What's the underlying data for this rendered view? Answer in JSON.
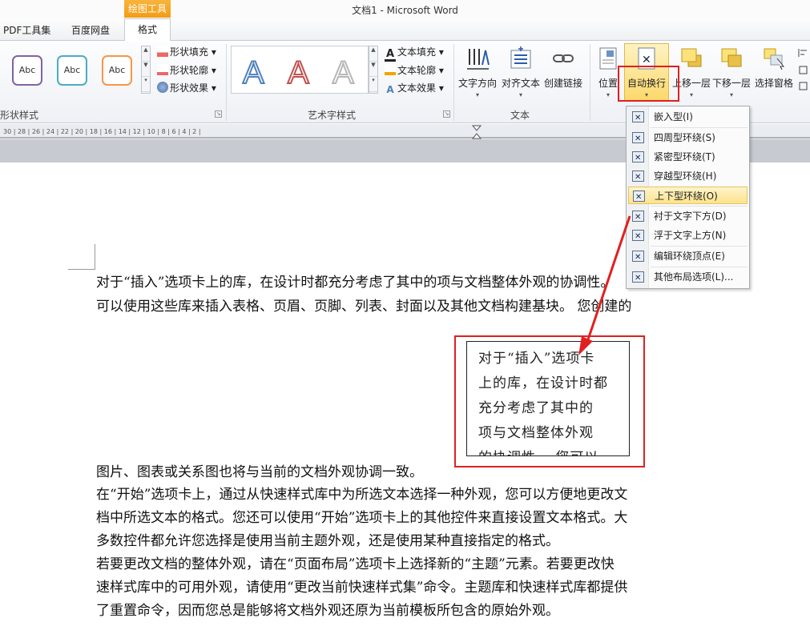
{
  "window": {
    "title": "文档1 - Microsoft Word"
  },
  "tabs": {
    "context_group": "绘图工具",
    "pdf": "PDF工具集",
    "baidu": "百度网盘",
    "format": "格式"
  },
  "ribbon": {
    "shape_styles": {
      "label": "形状样式",
      "sample": "Abc",
      "fill": "形状填充",
      "outline": "形状轮廓",
      "effect": "形状效果"
    },
    "wordart": {
      "label": "艺术字样式",
      "fill": "文本填充",
      "outline": "文本轮廓",
      "effect": "文本效果"
    },
    "text": {
      "label": "文本",
      "direction": "文字方向",
      "align": "对齐文本",
      "link": "创建链接"
    },
    "arrange": {
      "position": "位置",
      "wrap": "自动换行",
      "forward": "上移一层",
      "backward": "下移一层",
      "pane": "选择窗格"
    }
  },
  "ruler": {
    "numbers": "30 | 28 | 26 | 24 | 22 | 20 | 18 | 16 | 14 | 12 | 10 | 8 | 6 | 4 | 2 |"
  },
  "wrap_menu": {
    "items": [
      "嵌入型(I)",
      "四周型环绕(S)",
      "紧密型环绕(T)",
      "穿越型环绕(H)",
      "上下型环绕(O)",
      "衬于文字下方(D)",
      "浮于文字上方(N)",
      "编辑环绕顶点(E)",
      "其他布局选项(L)..."
    ],
    "highlighted": "上下型环绕(O)"
  },
  "document": {
    "para1_line1": "对于“插入”选项卡上的库，在设计时都充分考虑了其中的项与文档整体外观的协调性。",
    "para1_line2": "可以使用这些库来插入表格、页眉、页脚、列表、封面以及其他文档构建基块。 您创建的",
    "after_box": "图片、图表或关系图也将与当前的文档外观协调一致。",
    "para2_line1": "在“开始”选项卡上，通过从快速样式库中为所选文本选择一种外观，您可以方便地更改文",
    "para2_line2": "档中所选文本的格式。您还可以使用“开始”选项卡上的其他控件来直接设置文本格式。大",
    "para2_line3": "多数控件都允许您选择是使用当前主题外观，还是使用某种直接指定的格式。",
    "para3_line1": "若要更改文档的整体外观，请在“页面布局”选项卡上选择新的“主题”元素。若要更改快",
    "para3_line2": "速样式库中的可用外观，请使用“更改当前快速样式集”命令。主题库和快速样式库都提供",
    "para3_line3": "了重置命令，因而您总是能够将文档外观还原为当前模板所包含的原始外观。",
    "textbox_lines": [
      "对于“插入”选项卡",
      "上的库，在设计时都",
      "充分考虑了其中的",
      "项与文档整体外观",
      "的协调性。 您可以"
    ]
  },
  "colors": {
    "annotation_red": "#e02020",
    "context_tab": "#f39c12",
    "menu_highlight": "#fde38c"
  }
}
